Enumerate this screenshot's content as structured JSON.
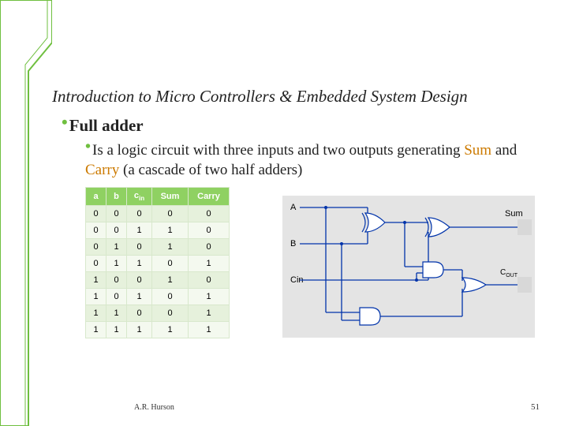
{
  "title": "Introduction to Micro Controllers & Embedded System Design",
  "bullet1": "Full adder",
  "bullet2_prefix": "Is  a logic circuit with three inputs and two outputs generating ",
  "bullet2_sum": "Sum",
  "bullet2_mid": " and ",
  "bullet2_carry": "Carry",
  "bullet2_suffix": " (a cascade of two half adders)",
  "table": {
    "headers": {
      "a": "a",
      "b": "b",
      "cin_base": "c",
      "cin_sub": "in",
      "sum": "Sum",
      "carry": "Carry"
    },
    "rows": [
      {
        "a": "0",
        "b": "0",
        "c": "0",
        "s": "0",
        "y": "0"
      },
      {
        "a": "0",
        "b": "0",
        "c": "1",
        "s": "1",
        "y": "0"
      },
      {
        "a": "0",
        "b": "1",
        "c": "0",
        "s": "1",
        "y": "0"
      },
      {
        "a": "0",
        "b": "1",
        "c": "1",
        "s": "0",
        "y": "1"
      },
      {
        "a": "1",
        "b": "0",
        "c": "0",
        "s": "1",
        "y": "0"
      },
      {
        "a": "1",
        "b": "0",
        "c": "1",
        "s": "0",
        "y": "1"
      },
      {
        "a": "1",
        "b": "1",
        "c": "0",
        "s": "0",
        "y": "1"
      },
      {
        "a": "1",
        "b": "1",
        "c": "1",
        "s": "1",
        "y": "1"
      }
    ]
  },
  "diagram": {
    "input_a": "A",
    "input_b": "B",
    "input_cin": "Cin",
    "output_sum": "Sum",
    "output_cout_base": "C",
    "output_cout_sub": "OUT"
  },
  "footer": {
    "author": "A.R. Hurson",
    "page": "51"
  },
  "chart_data": {
    "type": "table",
    "title": "Full adder truth table",
    "columns": [
      "a",
      "b",
      "cin",
      "Sum",
      "Carry"
    ],
    "rows": [
      [
        0,
        0,
        0,
        0,
        0
      ],
      [
        0,
        0,
        1,
        1,
        0
      ],
      [
        0,
        1,
        0,
        1,
        0
      ],
      [
        0,
        1,
        1,
        0,
        1
      ],
      [
        1,
        0,
        0,
        1,
        0
      ],
      [
        1,
        0,
        1,
        0,
        1
      ],
      [
        1,
        1,
        0,
        0,
        1
      ],
      [
        1,
        1,
        1,
        1,
        1
      ]
    ]
  }
}
